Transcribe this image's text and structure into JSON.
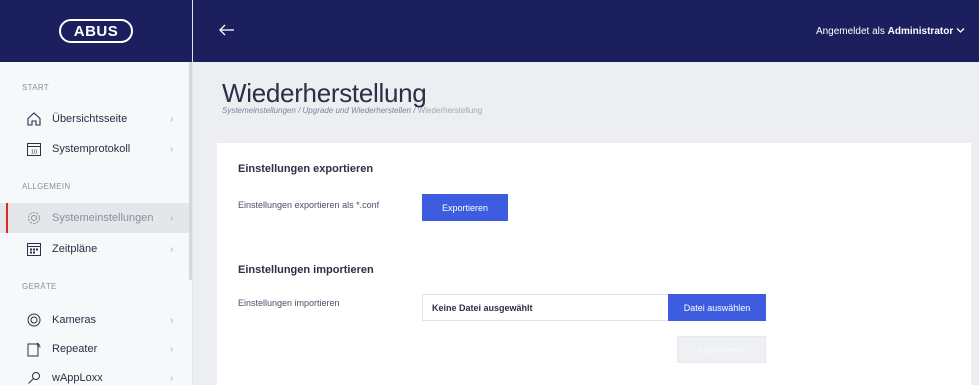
{
  "brand": {
    "logo_text": "ABUS"
  },
  "topbar": {
    "back_icon": "arrow-left-icon",
    "user_prefix": "Angemeldet als",
    "user_name": "Administrator",
    "user_chevron": "chevron-down-icon"
  },
  "sidebar": {
    "sections": [
      {
        "label": "START"
      },
      {
        "label": "ALLGEMEIN"
      },
      {
        "label": "GERÄTE"
      }
    ],
    "items": [
      {
        "label": "Übersichtsseite",
        "icon": "home-icon"
      },
      {
        "label": "Systemprotokoll",
        "icon": "calendar-10-icon"
      },
      {
        "label": "Systemeinstellungen",
        "icon": "gear-icon",
        "active": true
      },
      {
        "label": "Zeitpläne",
        "icon": "schedule-icon"
      },
      {
        "label": "Kameras",
        "icon": "camera-icon"
      },
      {
        "label": "Repeater",
        "icon": "repeater-icon"
      },
      {
        "label": "wAppLoxx",
        "icon": "key-icon"
      }
    ],
    "active_color": "#d62a2a"
  },
  "page": {
    "title": "Wiederherstellung",
    "breadcrumb": {
      "crumb1": "Systemeinstellungen",
      "sep1": "/",
      "crumb2": "Upgrade und Wiederherstellen",
      "sep2": "/",
      "current": "Wiederherstellung"
    }
  },
  "export": {
    "title": "Einstellungen exportieren",
    "label": "Einstellungen exportieren als *.conf",
    "button": "Exportieren"
  },
  "import": {
    "title": "Einstellungen importieren",
    "label": "Einstellungen importieren",
    "file_value": "Keine Datei ausgewählt",
    "choose_button": "Datei auswählen",
    "submit_button": "Importieren"
  },
  "colors": {
    "nav_bg": "#1c1f5e",
    "primary_button": "#3d5ce0"
  }
}
